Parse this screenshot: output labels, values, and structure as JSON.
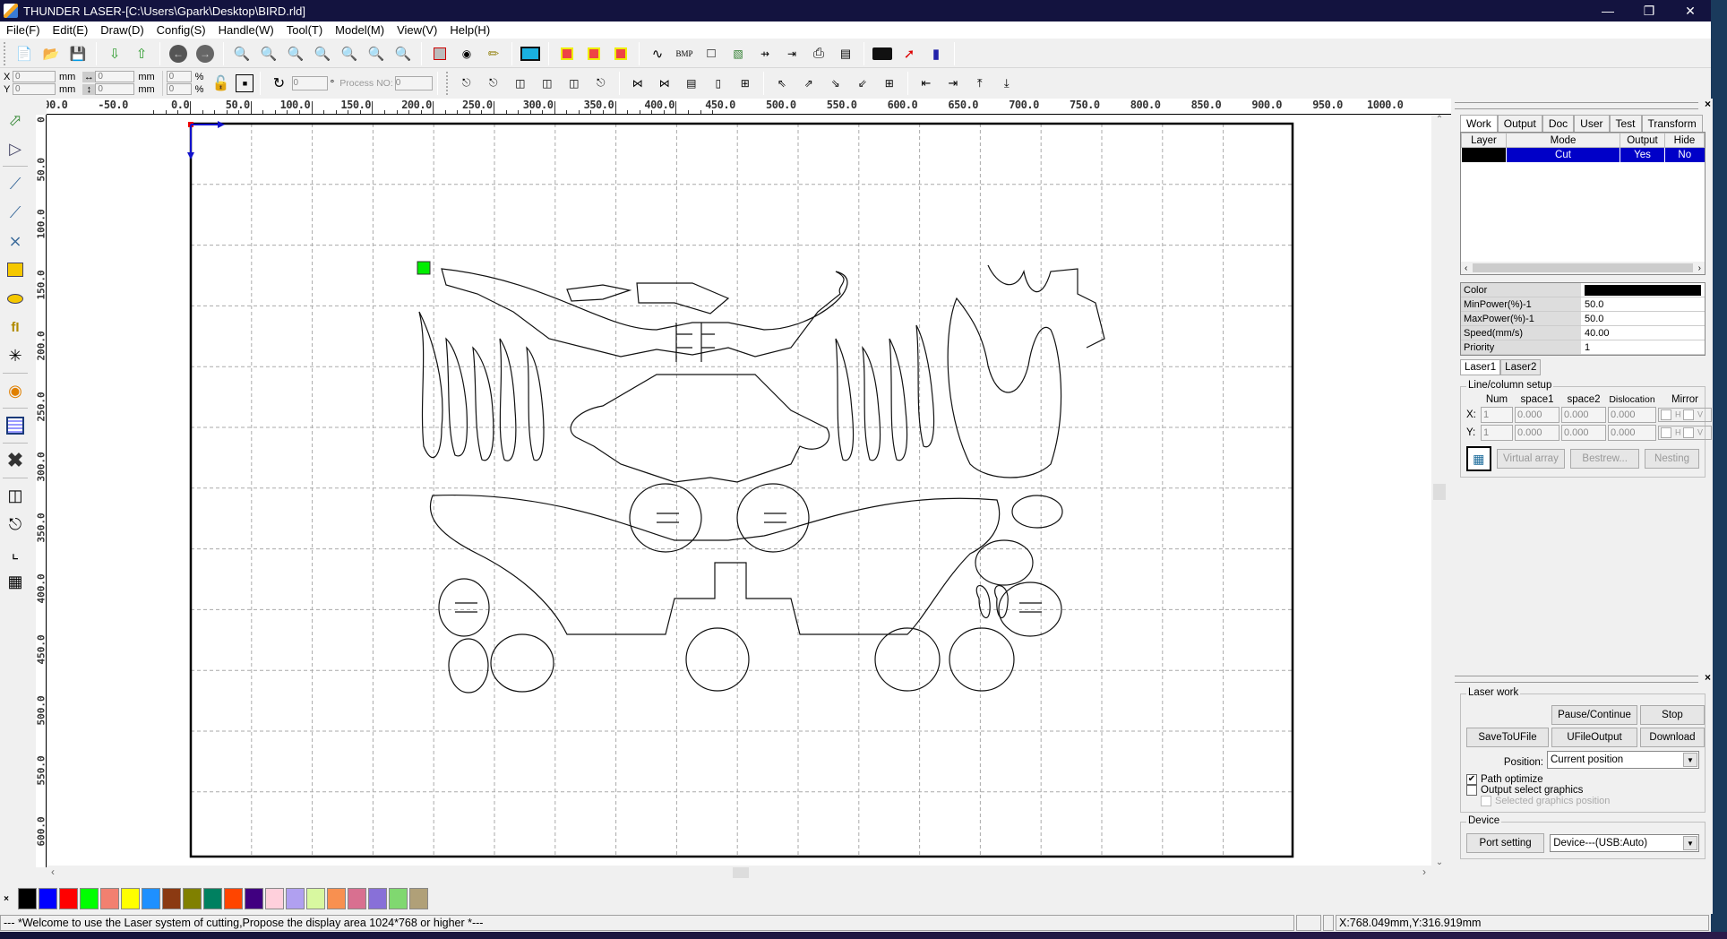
{
  "window": {
    "title": "THUNDER LASER-[C:\\Users\\Gpark\\Desktop\\BIRD.rld]",
    "controls": [
      "minimize",
      "restore",
      "close"
    ]
  },
  "menu": [
    "File(F)",
    "Edit(E)",
    "Draw(D)",
    "Config(S)",
    "Handle(W)",
    "Tool(T)",
    "Model(M)",
    "View(V)",
    "Help(H)"
  ],
  "toolbar": {
    "main_icons": [
      "new-file",
      "open-folder",
      "save",
      "import",
      "export",
      "undo",
      "redo",
      "zoom-fit",
      "zoom-in",
      "zoom-out",
      "zoom-page",
      "zoom-grid",
      "zoom-auto",
      "zoom-search",
      "select-rect",
      "node-edit",
      "pen-tool",
      "preview-monitor",
      "layer-select-a",
      "layer-select",
      "layer-select-dot",
      "curve",
      "bmp",
      "rectangle",
      "tree",
      "dist-h",
      "align-edge",
      "print",
      "layer-list",
      "camera",
      "red-laser",
      "ruler"
    ],
    "bmp_label": "BMP"
  },
  "coords": {
    "x_label": "X",
    "y_label": "Y",
    "x_value": "0",
    "y_value": "0",
    "w_value": "0",
    "h_value": "0",
    "unit": "mm",
    "scale_x": "0",
    "scale_y": "0",
    "pct": "%",
    "rotate_value": "0",
    "degree": "°",
    "process_no_label": "Process NO:",
    "process_no_value": "0"
  },
  "align_icons": [
    "align-top-diamond",
    "align-bottom-diamond",
    "align-left-diamond",
    "align-right-diamond",
    "center-h",
    "center-v",
    "space-h",
    "space-v",
    "same-width",
    "same-height",
    "same-size",
    "corner-tl",
    "corner-tr",
    "corner-br",
    "corner-bl",
    "corner-center",
    "arrow-left",
    "arrow-right",
    "arrow-up",
    "arrow-down"
  ],
  "left_tools": [
    "select-arrow",
    "node-select",
    "line",
    "polyline",
    "bezier",
    "rectangle",
    "ellipse",
    "text",
    "point",
    "webcam",
    "grid-array",
    "delete-x",
    "mirror-h",
    "mirror-v",
    "frame-corner",
    "array-grid"
  ],
  "rulers": {
    "top": [
      "00.0",
      "-50.0",
      "0.0",
      "50.0",
      "100.0",
      "150.0",
      "200.0",
      "250.0",
      "300.0",
      "350.0",
      "400.0",
      "450.0",
      "500.0",
      "550.0",
      "600.0",
      "650.0",
      "700.0",
      "750.0",
      "800.0",
      "850.0",
      "900.0",
      "950.0",
      "1000.0"
    ],
    "left": [
      "0",
      "50.0",
      "100.0",
      "150.0",
      "200.0",
      "250.0",
      "300.0",
      "350.0",
      "400.0",
      "450.0",
      "500.0",
      "550.0",
      "600.0"
    ]
  },
  "palette": [
    "#000000",
    "#0000ff",
    "#ff0000",
    "#00ff00",
    "#f28070",
    "#ffff00",
    "#1e90ff",
    "#8b3a12",
    "#808000",
    "#008060",
    "#ff4500",
    "#400080",
    "#ffd0dc",
    "#b0a0f0",
    "#d8f8a0",
    "#f89050",
    "#d87090",
    "#8870d8",
    "#80d870",
    "#b0a078"
  ],
  "status": {
    "message": "--- *Welcome to use the Laser system of cutting,Propose the display area 1024*768 or higher *---",
    "coords": "X:768.049mm,Y:316.919mm"
  },
  "panel": {
    "tabs": [
      "Work",
      "Output",
      "Doc",
      "User",
      "Test",
      "Transform"
    ],
    "active_tab": "Work",
    "layer_table": {
      "headers": [
        "Layer",
        "Mode",
        "Output",
        "Hide"
      ],
      "rows": [
        {
          "color": "#000000",
          "mode": "Cut",
          "output": "Yes",
          "hide": "No"
        }
      ]
    },
    "props": [
      {
        "label": "Color",
        "value": "",
        "swatch": "#000000"
      },
      {
        "label": "MinPower(%)-1",
        "value": "50.0"
      },
      {
        "label": "MaxPower(%)-1",
        "value": "50.0"
      },
      {
        "label": "Speed(mm/s)",
        "value": "40.00"
      },
      {
        "label": "Priority",
        "value": "1"
      }
    ],
    "laser_tabs": [
      "Laser1",
      "Laser2"
    ],
    "array": {
      "title": "Line/column setup",
      "headers": [
        "Num",
        "space1",
        "space2",
        "Dislocation",
        "Mirror"
      ],
      "x_label": "X:",
      "y_label": "Y:",
      "x": {
        "num": "1",
        "space1": "0.000",
        "space2": "0.000",
        "dislocation": "0.000"
      },
      "y": {
        "num": "1",
        "space1": "0.000",
        "space2": "0.000",
        "dislocation": "0.000"
      },
      "mirror_h": "H",
      "mirror_v": "V",
      "buttons": [
        "Virtual array",
        "Bestrew...",
        "Nesting"
      ]
    }
  },
  "laser_work": {
    "title": "Laser work",
    "buttons": {
      "pause": "Pause/Continue",
      "stop": "Stop",
      "save": "SaveToUFile",
      "ufile": "UFileOutput",
      "download": "Download"
    },
    "position_label": "Position:",
    "position_value": "Current position",
    "path_optimize": {
      "label": "Path optimize",
      "checked": true
    },
    "output_select": {
      "label": "Output select graphics",
      "checked": false
    },
    "selected_pos": {
      "label": "Selected graphics position",
      "checked": false
    },
    "device_title": "Device",
    "port_setting": "Port setting",
    "device_value": "Device---(USB:Auto)"
  }
}
